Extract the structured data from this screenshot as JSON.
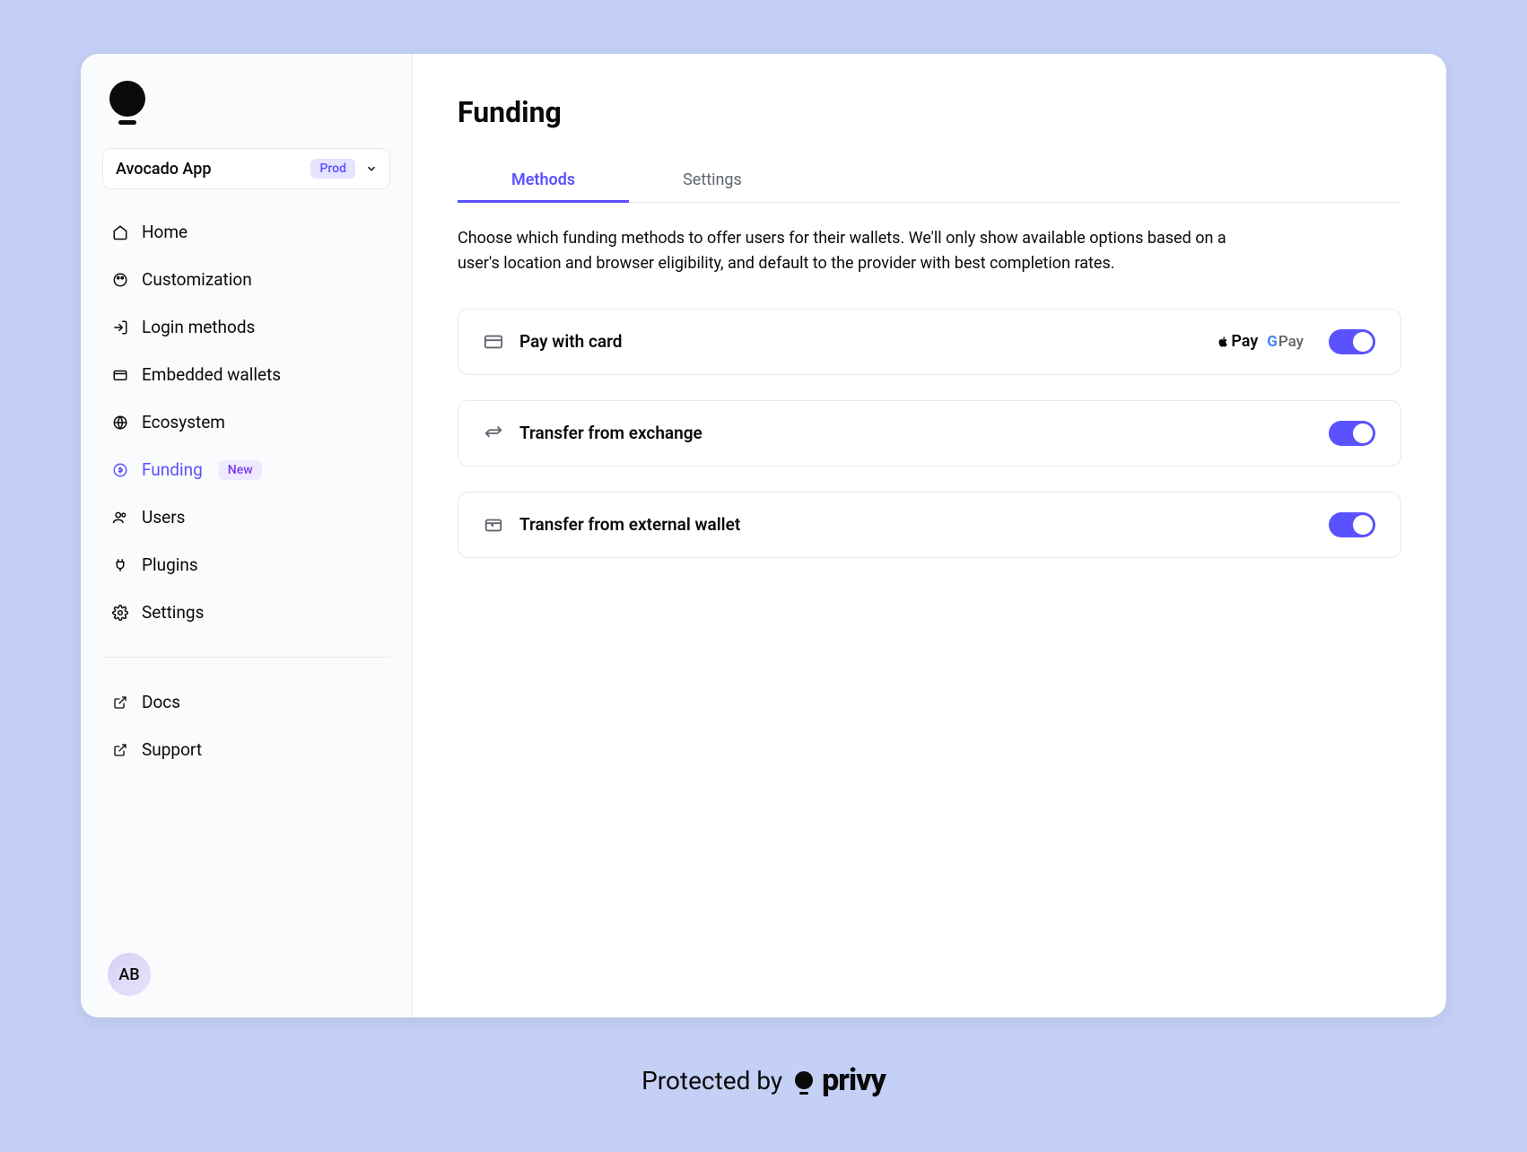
{
  "app": {
    "name": "Avocado App",
    "env": "Prod"
  },
  "sidebar": {
    "items": [
      {
        "label": "Home"
      },
      {
        "label": "Customization"
      },
      {
        "label": "Login methods"
      },
      {
        "label": "Embedded wallets"
      },
      {
        "label": "Ecosystem"
      },
      {
        "label": "Funding",
        "badge": "New"
      },
      {
        "label": "Users"
      },
      {
        "label": "Plugins"
      },
      {
        "label": "Settings"
      }
    ],
    "secondary": [
      {
        "label": "Docs"
      },
      {
        "label": "Support"
      }
    ]
  },
  "avatar": "AB",
  "page": {
    "title": "Funding",
    "tabs": [
      {
        "label": "Methods",
        "active": true
      },
      {
        "label": "Settings",
        "active": false
      }
    ],
    "description": "Choose which funding methods to offer users for their wallets. We'll only show available options based on a user's location and browser eligibility, and default to the provider with best completion rates.",
    "methods": [
      {
        "title": "Pay with card",
        "enabled": true,
        "payLogos": true
      },
      {
        "title": "Transfer from exchange",
        "enabled": true
      },
      {
        "title": "Transfer from external wallet",
        "enabled": true
      }
    ],
    "payLabels": {
      "apple": "Pay",
      "gpay_g": "G",
      "gpay_rest": " Pay"
    }
  },
  "footer": {
    "text": "Protected by",
    "brand": "privy"
  }
}
